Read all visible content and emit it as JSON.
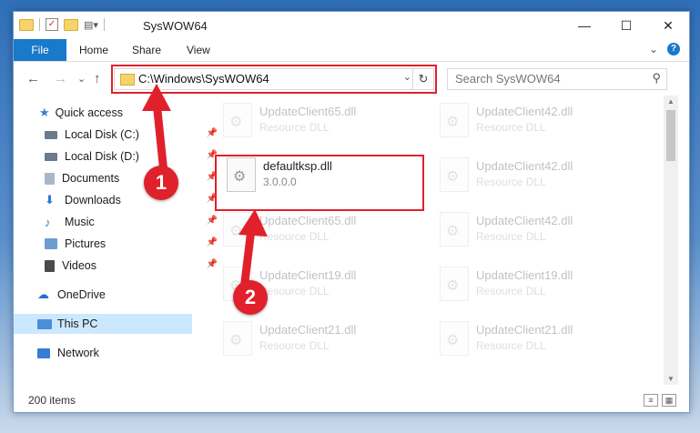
{
  "window": {
    "title": "SysWOW64",
    "controls": {
      "minimize": "—",
      "maximize": "☐",
      "close": "✕"
    }
  },
  "ribbon": {
    "tabs": [
      "File",
      "Home",
      "Share",
      "View"
    ],
    "collapse_glyph": "⌄",
    "help_glyph": "?"
  },
  "nav": {
    "back": "←",
    "forward": "→",
    "recent": "⌄",
    "up": "↑",
    "address": "C:\\Windows\\SysWOW64",
    "address_dropdown": "⌄",
    "refresh": "↻",
    "search_placeholder": "Search SysWOW64",
    "search_icon": "⚲"
  },
  "sidebar": {
    "items": [
      {
        "label": "Quick access",
        "icon": "star-icon",
        "color": "#3a7bd5"
      },
      {
        "label": "Local Disk (C:)",
        "icon": "drive-icon",
        "color": "#6b7a8c"
      },
      {
        "label": "Local Disk (D:)",
        "icon": "drive-icon",
        "color": "#6b7a8c"
      },
      {
        "label": "Documents",
        "icon": "documents-icon",
        "color": "#7a8ea6"
      },
      {
        "label": "Downloads",
        "icon": "downloads-icon",
        "color": "#2a78d6"
      },
      {
        "label": "Music",
        "icon": "music-icon",
        "color": "#2a78d6"
      },
      {
        "label": "Pictures",
        "icon": "pictures-icon",
        "color": "#6f9ccf"
      },
      {
        "label": "Videos",
        "icon": "videos-icon",
        "color": "#5a5a5a"
      },
      {
        "label": "OneDrive",
        "icon": "cloud-icon",
        "color": "#1f6fd1"
      },
      {
        "label": "This PC",
        "icon": "computer-icon",
        "color": "#4a8fd8"
      },
      {
        "label": "Network",
        "icon": "network-icon",
        "color": "#3a7bd5"
      }
    ],
    "pin_glyph": "📌"
  },
  "files": [
    {
      "name": "UpdateClient65.dll",
      "type": "Resource DLL"
    },
    {
      "name": "UpdateClient42.dll",
      "type": "Resource DLL"
    },
    {
      "name": "defaultksp.dll",
      "type": "3.0.0.0"
    },
    {
      "name": "UpdateClient42.dll",
      "type": "Resource DLL"
    },
    {
      "name": "UpdateClient65.dll",
      "type": "Resource DLL"
    },
    {
      "name": "UpdateClient42.dll",
      "type": "Resource DLL"
    },
    {
      "name": "UpdateClient19.dll",
      "type": "Resource DLL"
    },
    {
      "name": "UpdateClient19.dll",
      "type": "Resource DLL"
    },
    {
      "name": "UpdateClient21.dll",
      "type": "Resource DLL"
    },
    {
      "name": "UpdateClient21.dll",
      "type": "Resource DLL"
    }
  ],
  "status": {
    "items_count": "200 items"
  },
  "annotations": {
    "step1": "1",
    "step2": "2",
    "color": "#e0212b"
  }
}
